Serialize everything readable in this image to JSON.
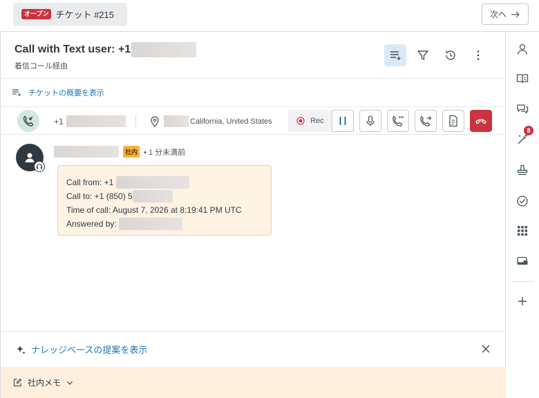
{
  "tab": {
    "status_badge": "オープン",
    "title": "チケット #215"
  },
  "nav": {
    "next_label": "次へ"
  },
  "ticket": {
    "title": "Call with Text user: +1",
    "subtitle": "着信コール経由",
    "summary_link": "チケットの概要を表示"
  },
  "call": {
    "number_prefix": "+1",
    "location": "California, United States",
    "rec_label": "Rec"
  },
  "message": {
    "tag": "社内",
    "time": "• 1 分未満前",
    "call_from": "Call from: +1",
    "call_to": "Call to: +1 (850) 5",
    "time_of_call": "Time of call: August 7, 2026 at 8:19:41 PM UTC",
    "answered_by": "Answered by: "
  },
  "knowledge": {
    "link": "ナレッジベースの提案を表示"
  },
  "memo": {
    "label": "社内メモ"
  },
  "sidebar": {
    "apps_badge": "8"
  },
  "colors": {
    "accent": "#1f73b7",
    "danger": "#cc3340",
    "internal": "#fbb13c",
    "note_bg": "#fff3e3"
  }
}
